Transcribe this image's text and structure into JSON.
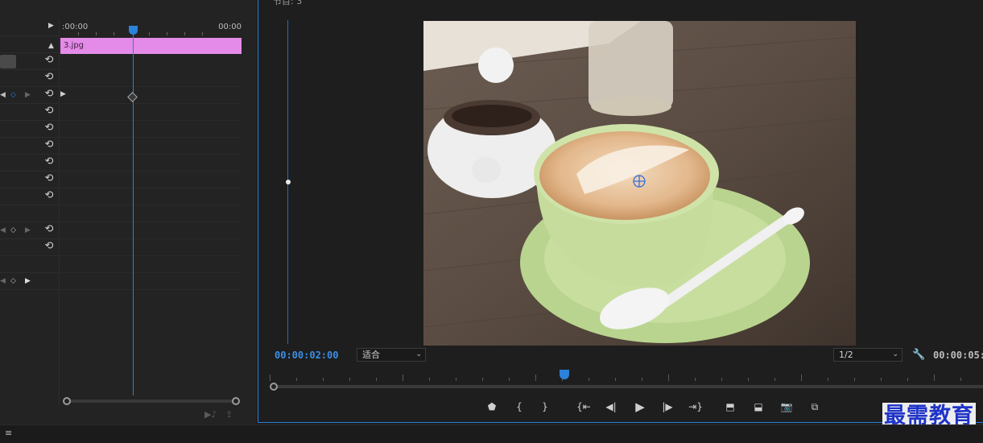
{
  "effect_controls": {
    "ruler_start": ":00:00",
    "ruler_end": "00:00",
    "clip_name": "3.jpg",
    "reset_glyph": "⟲",
    "icons": {
      "expand_arrow": "play-right-icon",
      "collapse_arrow": "triangle-up-icon",
      "reset": "reset-parameter-icon",
      "keyframe": "keyframe-diamond-icon",
      "filter_audio": "filter-audio-icon",
      "export": "export-icon"
    }
  },
  "program_monitor": {
    "title": "节目: 3",
    "timecode_current": "00:00:02:00",
    "zoom_select": "适合",
    "resolution_select": "1/2",
    "timecode_duration": "00:00:05:",
    "accent_color": "#2a82da",
    "transport_buttons": [
      {
        "name": "add-marker-button",
        "icon": "marker-icon"
      },
      {
        "name": "mark-in-button",
        "icon": "mark-in-icon"
      },
      {
        "name": "mark-out-button",
        "icon": "mark-out-icon"
      },
      {
        "name": "go-to-in-button",
        "icon": "go-to-in-icon"
      },
      {
        "name": "step-back-button",
        "icon": "step-back-icon"
      },
      {
        "name": "play-button",
        "icon": "play-icon"
      },
      {
        "name": "step-forward-button",
        "icon": "step-forward-icon"
      },
      {
        "name": "go-to-out-button",
        "icon": "go-to-out-icon"
      },
      {
        "name": "lift-button",
        "icon": "lift-icon"
      },
      {
        "name": "extract-button",
        "icon": "extract-icon"
      },
      {
        "name": "export-frame-button",
        "icon": "camera-icon"
      },
      {
        "name": "comparison-view-button",
        "icon": "compare-icon"
      }
    ]
  },
  "watermark": "最需教育",
  "photo": {
    "subject": "latte-art-coffee-cup-photo"
  }
}
